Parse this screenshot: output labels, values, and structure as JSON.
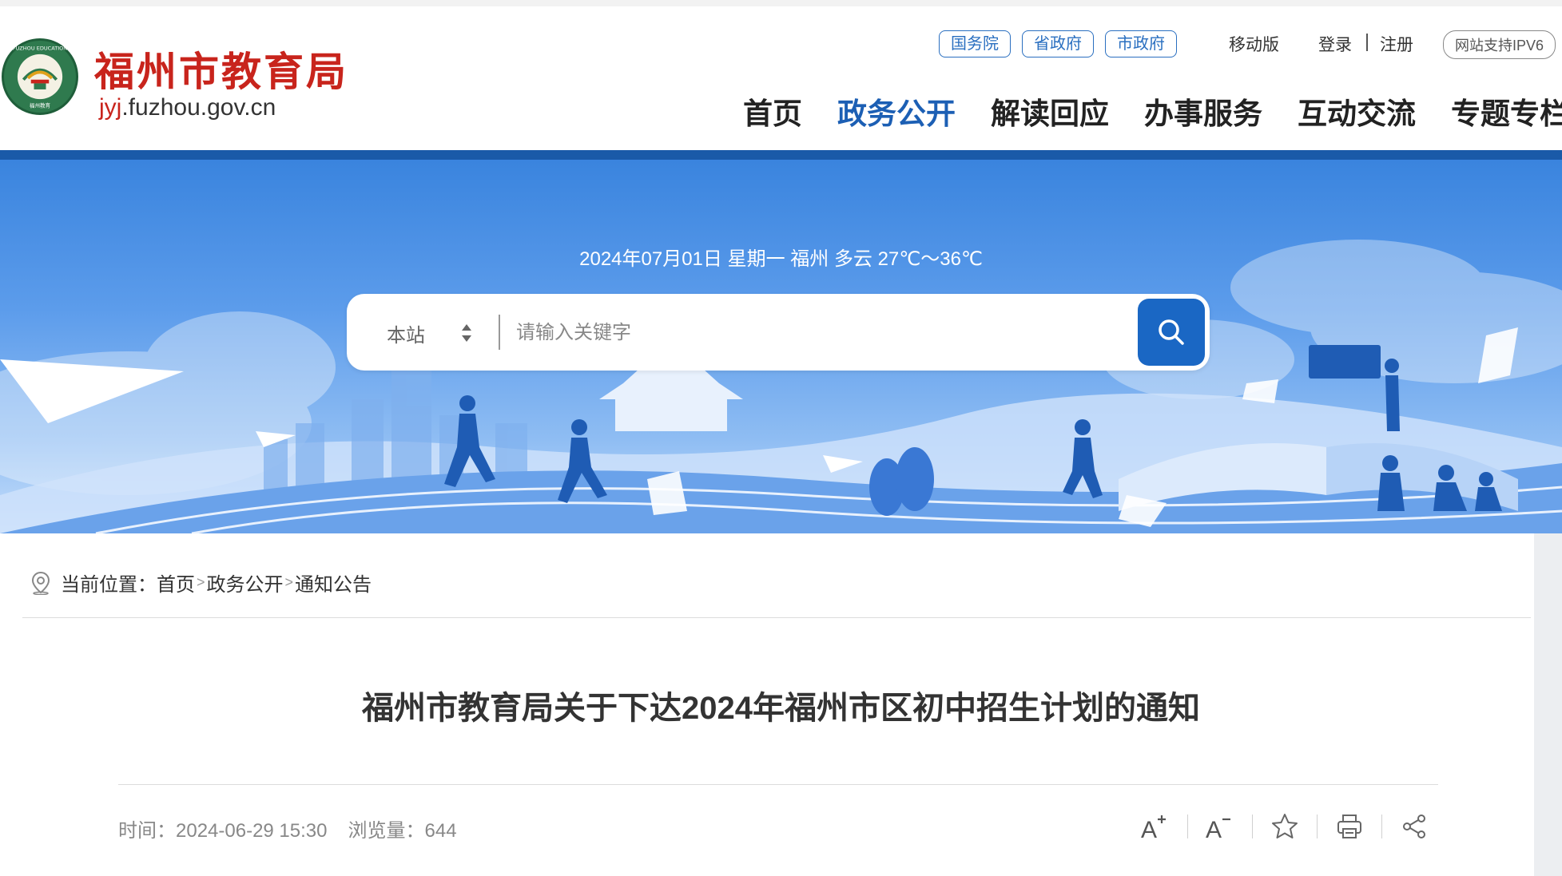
{
  "header": {
    "site_title": "福州市教育局",
    "url_highlight": "jyj",
    "url_rest": ".fuzhou.gov.cn",
    "logo_ring_text": "FUZHOU EDUCATION",
    "logo_bottom_text": "福州教育",
    "gov_links": [
      "国务院",
      "省政府",
      "市政府"
    ],
    "mobile_label": "移动版",
    "login_label": "登录",
    "register_label": "注册",
    "ipv6_label": "网站支持IPV6"
  },
  "nav": {
    "items": [
      "首页",
      "政务公开",
      "解读回应",
      "办事服务",
      "互动交流",
      "专题专栏"
    ],
    "active_index": 1
  },
  "banner": {
    "weather": "2024年07月01日  星期一 福州 多云 27℃～36℃"
  },
  "search": {
    "scope": "本站",
    "placeholder": "请输入关键字"
  },
  "breadcrumb": {
    "label": "当前位置：",
    "items": [
      "首页",
      "政务公开",
      "通知公告"
    ],
    "separator": ">"
  },
  "article": {
    "title": "福州市教育局关于下达2024年福州市区初中招生计划的通知",
    "time": "时间：2024-06-29 15:30",
    "views": "浏览量：644"
  },
  "tools": {
    "font_increase": "A",
    "font_decrease": "A"
  },
  "colors": {
    "brand_red": "#c8241c",
    "nav_active": "#1c5fb4",
    "band_blue": "#1a5aa8",
    "search_button": "#1a67c4"
  }
}
